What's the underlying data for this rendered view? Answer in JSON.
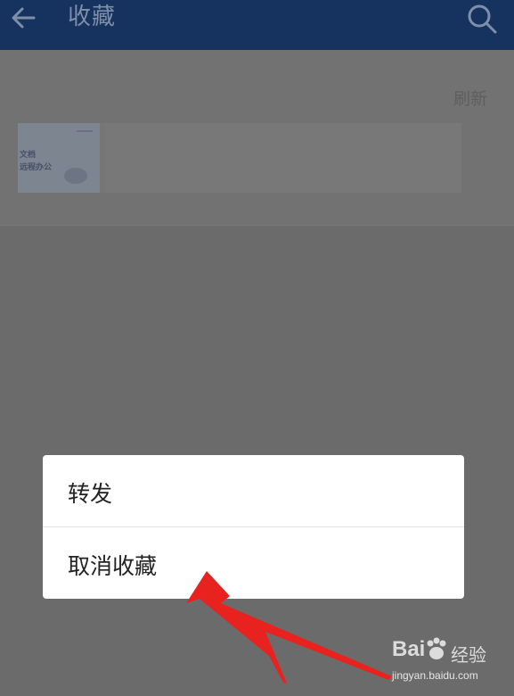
{
  "header": {
    "title": "收藏",
    "back_icon": "back-arrow-icon",
    "search_icon": "search-icon"
  },
  "content": {
    "refresh_label": "刷新",
    "card": {
      "thumbnail_lines": [
        "文档",
        "远程办公"
      ]
    }
  },
  "menu": {
    "items": [
      {
        "label": "转发"
      },
      {
        "label": "取消收藏"
      }
    ]
  },
  "watermark": {
    "brand": "Bai",
    "suffix": "经验",
    "url": "jingyan.baidu.com"
  },
  "colors": {
    "topbar": "#16325e",
    "overlay": "#6b6b6b",
    "menu_bg": "#ffffff",
    "arrow": "#e8231f"
  }
}
